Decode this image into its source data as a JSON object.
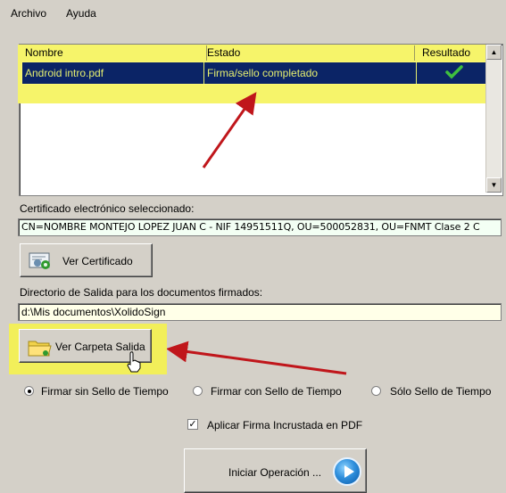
{
  "menu": {
    "file": "Archivo",
    "help": "Ayuda"
  },
  "table": {
    "columns": [
      "Nombre",
      "Estado",
      "Resultado"
    ],
    "rows": [
      {
        "name": "Android intro.pdf",
        "status": "Firma/sello completado",
        "result_icon": "check-icon"
      }
    ]
  },
  "certificate": {
    "label": "Certificado electrónico seleccionado:",
    "value": "CN=NOMBRE MONTEJO LOPEZ JUAN C - NIF 14951511Q, OU=500052831, OU=FNMT Clase 2 C",
    "view_button": "Ver Certificado"
  },
  "output": {
    "label": "Directorio de Salida para los documentos firmados:",
    "path": "d:\\Mis documentos\\XolidoSign",
    "view_button": "Ver Carpeta Salida"
  },
  "options": {
    "radios": [
      {
        "label": "Firmar sin Sello de Tiempo",
        "selected": true
      },
      {
        "label": "Firmar con Sello de Tiempo",
        "selected": false
      },
      {
        "label": "Sólo Sello de Tiempo",
        "selected": false
      }
    ],
    "embed_pdf": {
      "label": "Aplicar Firma Incrustada en PDF",
      "checked": true
    }
  },
  "start_button": "Iniciar Operación ...",
  "colors": {
    "highlight": "#f6f46a",
    "selection": "#0b2466",
    "arrow": "#c0161b",
    "check": "#2f9a2f"
  }
}
